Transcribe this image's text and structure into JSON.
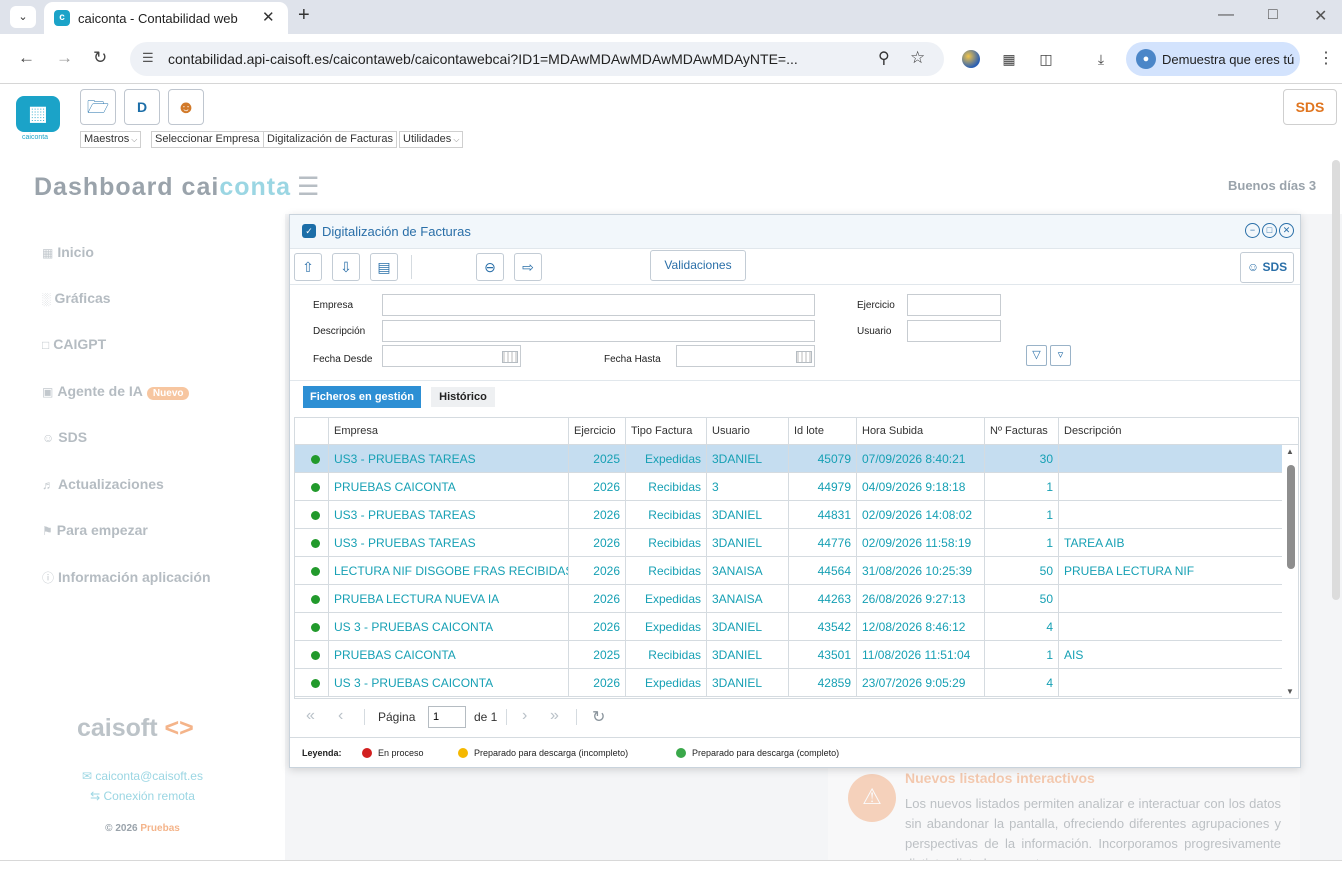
{
  "browser": {
    "tab_title": "caiconta - Contabilidad web",
    "url": "contabilidad.api-caisoft.es/caicontaweb/caicontawebcai?ID1=MDAwMDAwMDAwMDAwMDAyNTE=...",
    "profile_label": "Demuestra que eres tú"
  },
  "app": {
    "logo_text": "caiconta",
    "menus": [
      {
        "label": "Maestros"
      },
      {
        "label": "Seleccionar Empresa"
      },
      {
        "label": "Digitalización de Facturas"
      },
      {
        "label": "Utilidades"
      }
    ],
    "top_sds_label": "SDS",
    "dashboard_title_a": "Dashboard",
    "dashboard_title_b": "cai",
    "dashboard_title_c": "conta",
    "greeting": "Buenos días 3"
  },
  "sidebar": {
    "items": [
      {
        "label": "Inicio"
      },
      {
        "label": "Gráficas"
      },
      {
        "label": "CAIGPT"
      },
      {
        "label": "Agente de IA",
        "badge": "Nuevo"
      },
      {
        "label": "SDS"
      },
      {
        "label": "Actualizaciones"
      },
      {
        "label": "Para empezar"
      },
      {
        "label": "Información aplicación"
      }
    ],
    "brand": "caisoft",
    "email": "caiconta@caisoft.es",
    "remote": "Conexión remota",
    "copyright": "© 2026",
    "copyright_accent": "Pruebas"
  },
  "news": {
    "title": "Nuevos listados interactivos",
    "body": "Los nuevos listados permiten analizar e interactuar con los datos sin abandonar la pantalla, ofreciendo diferentes agrupaciones y perspectivas de la información. Incorporamos progresivamente distintos listados en esta"
  },
  "modal": {
    "title": "Digitalización de Facturas",
    "validaciones_label": "Validaciones",
    "sds_label": "SDS",
    "filters": {
      "empresa_label": "Empresa",
      "descripcion_label": "Descripción",
      "fecha_desde_label": "Fecha Desde",
      "fecha_hasta_label": "Fecha Hasta",
      "ejercicio_label": "Ejercicio",
      "usuario_label": "Usuario",
      "empresa_value": "",
      "descripcion_value": "",
      "fecha_desde_value": "",
      "fecha_hasta_value": "",
      "ejercicio_value": "",
      "usuario_value": ""
    },
    "tabs": [
      {
        "label": "Ficheros en gestión"
      },
      {
        "label": "Histórico"
      }
    ],
    "columns": [
      "Empresa",
      "Ejercicio",
      "Tipo Factura",
      "Usuario",
      "Id lote",
      "Hora Subida",
      "Nº Facturas",
      "Descripción"
    ],
    "rows": [
      {
        "empresa": "US3 - PRUEBAS TAREAS",
        "ejercicio": "2025",
        "tipo": "Expedidas",
        "usuario": "3DANIEL",
        "lote": "45079",
        "hora": "07/09/2026 8:40:21",
        "nfact": "30",
        "desc": ""
      },
      {
        "empresa": "PRUEBAS CAICONTA",
        "ejercicio": "2026",
        "tipo": "Recibidas",
        "usuario": "3",
        "lote": "44979",
        "hora": "04/09/2026 9:18:18",
        "nfact": "1",
        "desc": ""
      },
      {
        "empresa": "US3 - PRUEBAS TAREAS",
        "ejercicio": "2026",
        "tipo": "Recibidas",
        "usuario": "3DANIEL",
        "lote": "44831",
        "hora": "02/09/2026 14:08:02",
        "nfact": "1",
        "desc": ""
      },
      {
        "empresa": "US3 - PRUEBAS TAREAS",
        "ejercicio": "2026",
        "tipo": "Recibidas",
        "usuario": "3DANIEL",
        "lote": "44776",
        "hora": "02/09/2026 11:58:19",
        "nfact": "1",
        "desc": "TAREA AIB"
      },
      {
        "empresa": "LECTURA NIF DISGOBE FRAS RECIBIDAS",
        "ejercicio": "2026",
        "tipo": "Recibidas",
        "usuario": "3ANAISA",
        "lote": "44564",
        "hora": "31/08/2026 10:25:39",
        "nfact": "50",
        "desc": "PRUEBA LECTURA NIF"
      },
      {
        "empresa": "PRUEBA LECTURA NUEVA IA",
        "ejercicio": "2026",
        "tipo": "Expedidas",
        "usuario": "3ANAISA",
        "lote": "44263",
        "hora": "26/08/2026 9:27:13",
        "nfact": "50",
        "desc": ""
      },
      {
        "empresa": "US 3 - PRUEBAS CAICONTA",
        "ejercicio": "2026",
        "tipo": "Expedidas",
        "usuario": "3DANIEL",
        "lote": "43542",
        "hora": "12/08/2026 8:46:12",
        "nfact": "4",
        "desc": ""
      },
      {
        "empresa": "PRUEBAS CAICONTA",
        "ejercicio": "2025",
        "tipo": "Recibidas",
        "usuario": "3DANIEL",
        "lote": "43501",
        "hora": "11/08/2026 11:51:04",
        "nfact": "1",
        "desc": "AIS"
      },
      {
        "empresa": "US 3 - PRUEBAS CAICONTA",
        "ejercicio": "2026",
        "tipo": "Expedidas",
        "usuario": "3DANIEL",
        "lote": "42859",
        "hora": "23/07/2026 9:05:29",
        "nfact": "4",
        "desc": ""
      }
    ],
    "pager": {
      "page_label": "Página",
      "page_value": "1",
      "of_label": "de 1"
    },
    "legend": {
      "title": "Leyenda:",
      "items": [
        {
          "label": "En proceso",
          "color": "#d21f1f"
        },
        {
          "label": "Preparado para descarga (incompleto)",
          "color": "#f5b800"
        },
        {
          "label": "Preparado para descarga (completo)",
          "color": "#3aa84a"
        }
      ]
    }
  }
}
